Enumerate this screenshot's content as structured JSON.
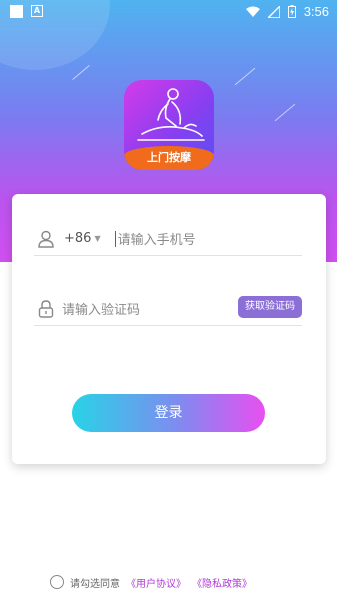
{
  "status_bar": {
    "time": "3:56",
    "left_icons": [
      "square-notification-icon",
      "a-notification-icon"
    ],
    "right_icons": [
      "wifi-icon",
      "signal-icon",
      "battery-icon"
    ]
  },
  "logo": {
    "title": "上门按摩",
    "icon": "massage-figure-icon"
  },
  "login_form": {
    "country_code": "+86",
    "phone_placeholder": "请输入手机号",
    "code_placeholder": "请输入验证码",
    "get_code_label": "获取验证码",
    "login_label": "登录"
  },
  "agreement": {
    "prefix": "请勾选同意",
    "user_agreement": "《用户协议》",
    "privacy_policy": "《隐私政策》"
  },
  "colors": {
    "gradient_top": "#4fb3f0",
    "gradient_bottom": "#d14ff0",
    "logo_ribbon": "#f06b1b",
    "get_code_bg": "#8b6fd6",
    "link": "#b03bd6"
  }
}
